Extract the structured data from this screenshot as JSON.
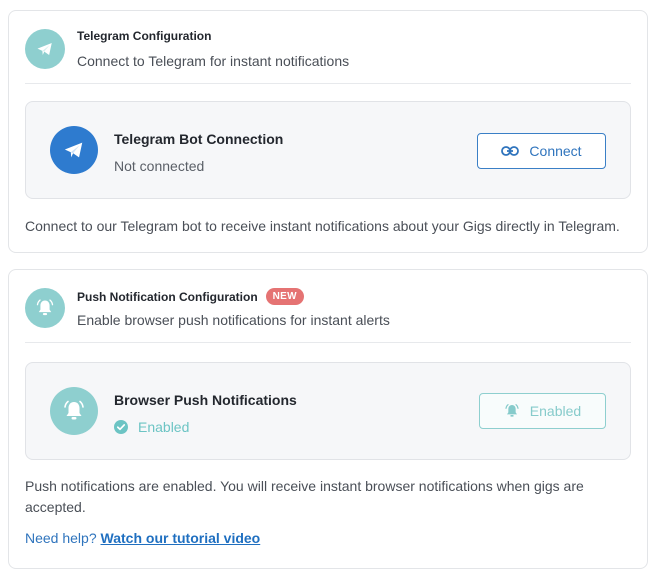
{
  "telegram": {
    "header_title": "Telegram Configuration",
    "header_subtitle": "Connect to Telegram for instant notifications",
    "panel_title": "Telegram Bot Connection",
    "panel_status": "Not connected",
    "connect_label": "Connect",
    "description": "Connect to our Telegram bot to receive instant notifications about your Gigs directly in Telegram."
  },
  "push": {
    "header_title": "Push Notification Configuration",
    "badge": "NEW",
    "header_subtitle": "Enable browser push notifications for instant alerts",
    "panel_title": "Browser Push Notifications",
    "panel_status": "Enabled",
    "enabled_label": "Enabled",
    "description": "Push notifications are enabled. You will receive instant browser notifications when gigs are accepted.",
    "help_prefix": "Need help?",
    "help_link": "Watch our tutorial video"
  },
  "icons": {
    "telegram": "telegram-plane-icon",
    "bell": "bell-ringing-icon",
    "link": "link-icon",
    "check": "check-circle-icon"
  },
  "colors": {
    "teal": "#8ecfcf",
    "blue": "#2e7bcf",
    "badge": "#e57373",
    "link": "#1f6fc0"
  }
}
